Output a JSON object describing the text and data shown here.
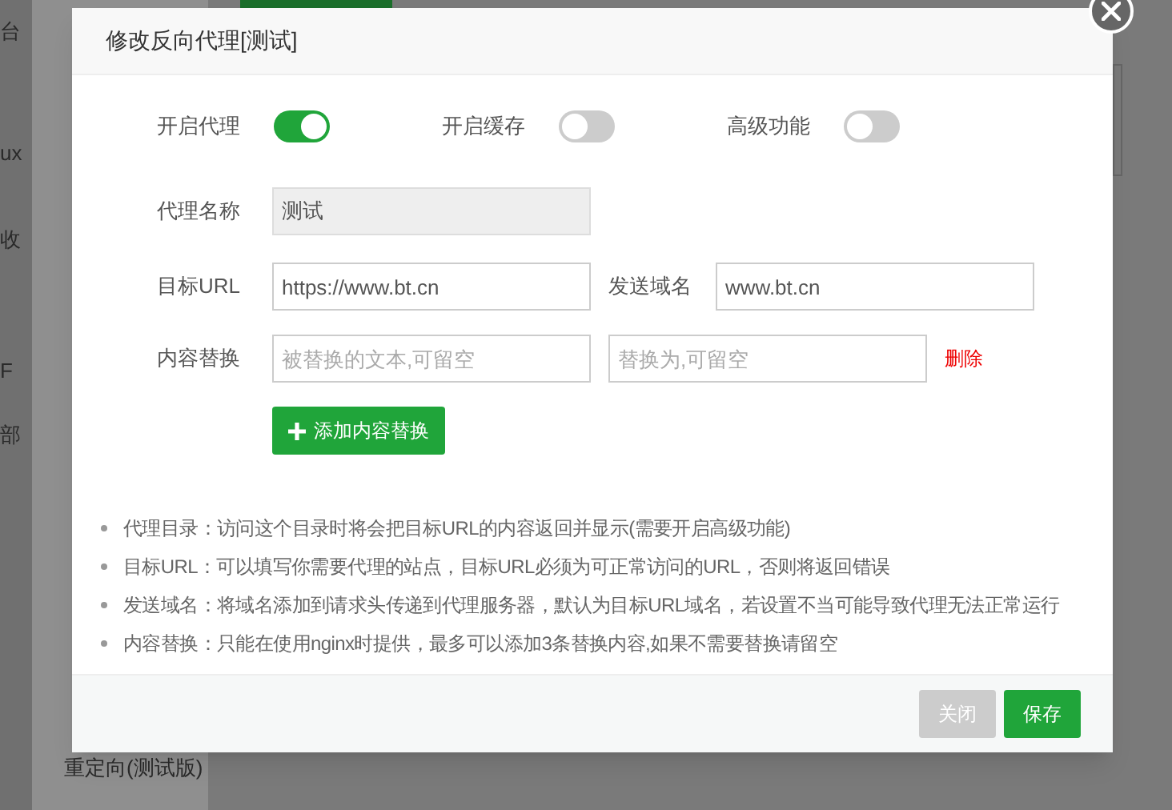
{
  "background": {
    "left_fragments": [
      "台",
      "ux",
      "收",
      "F",
      "部"
    ],
    "menu_fragments": [
      "重定向(测试版)"
    ]
  },
  "dialog": {
    "title": "修改反向代理[测试]",
    "toggles": [
      {
        "label": "开启代理",
        "on": true
      },
      {
        "label": "开启缓存",
        "on": false
      },
      {
        "label": "高级功能",
        "on": false
      }
    ],
    "proxy_name": {
      "label": "代理名称",
      "value": "测试",
      "disabled": true
    },
    "target_url": {
      "label": "目标URL",
      "value": "https://www.bt.cn"
    },
    "send_domain": {
      "label": "发送域名",
      "value": "www.bt.cn"
    },
    "replace": {
      "label": "内容替换",
      "from_placeholder": "被替换的文本,可留空",
      "to_placeholder": "替换为,可留空",
      "delete": "删除"
    },
    "add_button": "添加内容替换",
    "notes": [
      "代理目录：访问这个目录时将会把目标URL的内容返回并显示(需要开启高级功能)",
      "目标URL：可以填写你需要代理的站点，目标URL必须为可正常访问的URL，否则将返回错误",
      "发送域名：将域名添加到请求头传递到代理服务器，默认为目标URL域名，若设置不当可能导致代理无法正常运行",
      "内容替换：只能在使用nginx时提供，最多可以添加3条替换内容,如果不需要替换请留空"
    ],
    "buttons": [
      {
        "label": "关闭",
        "kind": "secondary"
      },
      {
        "label": "保存",
        "kind": "primary"
      }
    ]
  }
}
